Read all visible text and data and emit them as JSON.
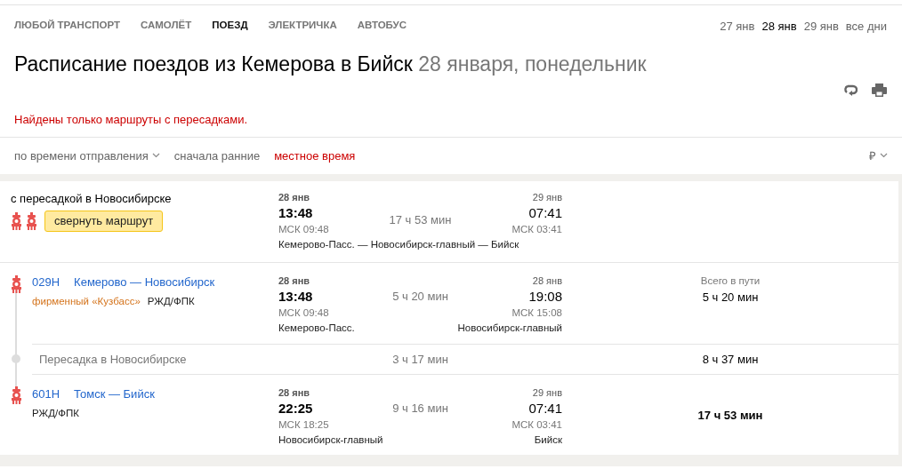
{
  "transport_tabs": [
    {
      "label": "ЛЮБОЙ ТРАНСПОРТ",
      "selected": false
    },
    {
      "label": "САМОЛЁТ",
      "selected": false
    },
    {
      "label": "ПОЕЗД",
      "selected": true
    },
    {
      "label": "ЭЛЕКТРИЧКА",
      "selected": false
    },
    {
      "label": "АВТОБУС",
      "selected": false
    }
  ],
  "date_tabs": [
    {
      "label": "27 янв",
      "selected": false
    },
    {
      "label": "28 янв",
      "selected": true
    },
    {
      "label": "29 янв",
      "selected": false
    },
    {
      "label": "все дни",
      "selected": false
    }
  ],
  "title": {
    "main": "Расписание поездов из Кемерова в Бийск",
    "date": "28 января, понедельник"
  },
  "notice": "Найдены только маршруты с пересадками.",
  "sort": {
    "order": "по времени отправления",
    "direction": "сначала ранние",
    "time_mode": "местное время",
    "currency": "₽"
  },
  "route": {
    "summary": {
      "title": "с пересадкой в Новосибирске",
      "collapse_button": "свернуть маршрут",
      "departure": {
        "date": "28 янв",
        "time": "13:48",
        "msk": "МСК 09:48"
      },
      "duration": "17 ч 53 мин",
      "arrival": {
        "date": "29 янв",
        "time": "07:41",
        "msk": "МСК 03:41"
      },
      "stations": "Кемерово-Пасс. — Новосибирск-главный — Бийск"
    },
    "items": [
      {
        "kind": "segment",
        "number": "029Н",
        "name": "Кемерово — Новосибирск",
        "brand": "фирменный «Кузбасс»",
        "carrier": "РЖД/ФПК",
        "departure": {
          "date": "28 янв",
          "time": "13:48",
          "msk": "МСК 09:48",
          "station": "Кемерово-Пасс."
        },
        "duration": "5 ч 20 мин",
        "arrival": {
          "date": "28 янв",
          "time": "19:08",
          "msk": "МСК 15:08",
          "station": "Новосибирск-главный"
        },
        "total_label": "Всего в пути",
        "total": "5 ч 20 мин"
      },
      {
        "kind": "transfer",
        "label": "Пересадка в Новосибирске",
        "duration": "3 ч 17 мин",
        "total": "8 ч 37 мин"
      },
      {
        "kind": "segment",
        "number": "601Н",
        "name": "Томск — Бийск",
        "carrier": "РЖД/ФПК",
        "departure": {
          "date": "28 янв",
          "time": "22:25",
          "msk": "МСК 18:25",
          "station": "Новосибирск-главный"
        },
        "duration": "9 ч 16 мин",
        "arrival": {
          "date": "29 янв",
          "time": "07:41",
          "msk": "МСК 03:41",
          "station": "Бийск"
        },
        "total": "17 ч 53 мин"
      }
    ]
  }
}
